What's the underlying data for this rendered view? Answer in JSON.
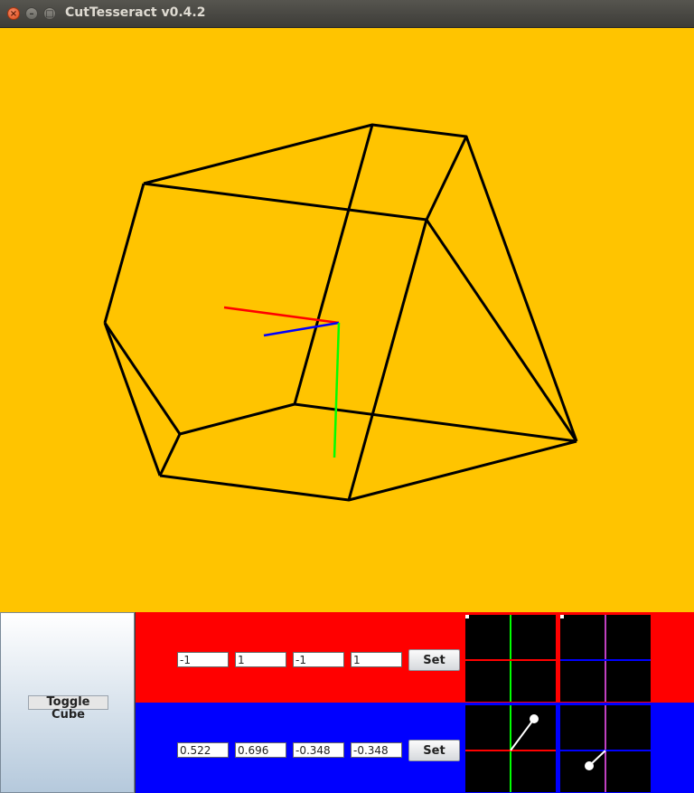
{
  "window": {
    "title": "CutTesseract v0.4.2"
  },
  "toggle_button": {
    "label": "Toggle Cube"
  },
  "rows": [
    {
      "color": "#ff0000",
      "values": [
        "-1",
        "1",
        "-1",
        "1"
      ],
      "set_label": "Set"
    },
    {
      "color": "#0000ff",
      "values": [
        "0.522",
        "0.696",
        "-0.348",
        "-0.348"
      ],
      "set_label": "Set"
    }
  ],
  "colors": {
    "canvas_background": "#ffc400",
    "axis_x": "#ff0000",
    "axis_y": "#00ff00",
    "axis_z": "#0000ff",
    "pad_background": "#000000",
    "pad_line_green": "#00ff00",
    "pad_line_magenta": "#c040c0",
    "pad_line_red": "#ff0000",
    "pad_line_blue": "#0000ff"
  },
  "icons": {
    "close": "close-icon",
    "minimize": "minimize-icon",
    "maximize": "maximize-icon"
  }
}
